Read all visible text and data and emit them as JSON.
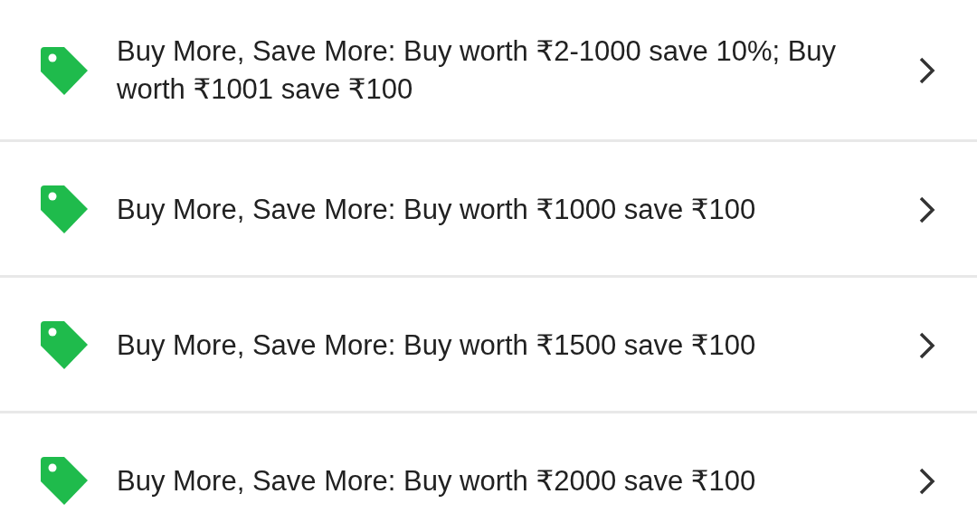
{
  "offers": [
    {
      "text": "Buy More, Save More: Buy worth ₹2-1000 save 10%; Buy worth ₹1001 save ₹100"
    },
    {
      "text": "Buy More, Save More: Buy worth ₹1000 save ₹100"
    },
    {
      "text": "Buy More, Save More: Buy worth ₹1500 save ₹100"
    },
    {
      "text": "Buy More, Save More: Buy worth ₹2000 save ₹100"
    }
  ]
}
